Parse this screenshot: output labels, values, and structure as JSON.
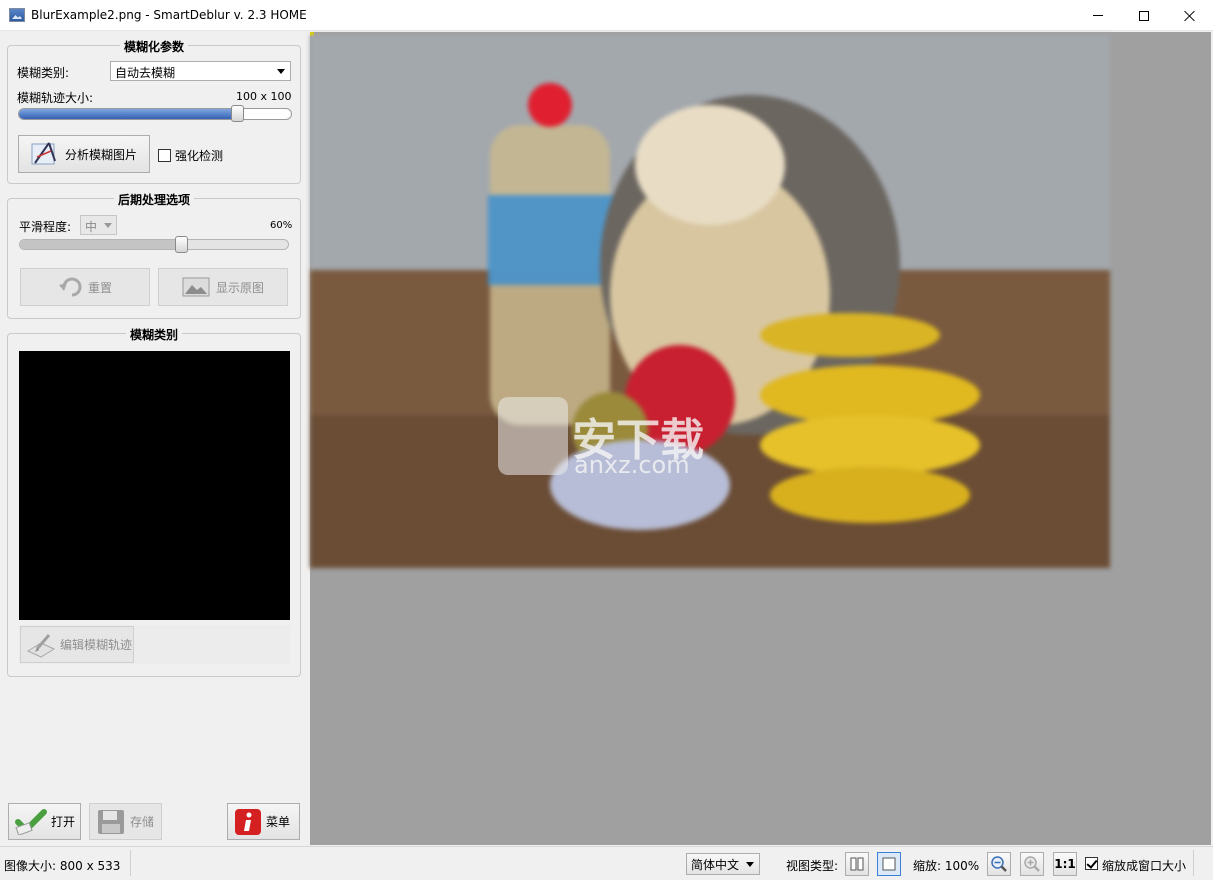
{
  "window": {
    "title": "BlurExample2.png - SmartDeblur v. 2.3 HOME"
  },
  "blur_params": {
    "group_title": "模糊化参数",
    "type_label": "模糊类别:",
    "type_value": "自动去模糊",
    "size_label": "模糊轨迹大小:",
    "size_value_w": "100",
    "size_value_x": "x",
    "size_value_h": "100",
    "size_slider_fraction": 0.8,
    "analyze_button": "分析模糊图片",
    "enhance_checkbox_label": "强化检测",
    "enhance_checked": false
  },
  "post_processing": {
    "group_title": "后期处理选项",
    "smooth_label": "平滑程度:",
    "smooth_value": "中",
    "smooth_percent": "60%",
    "smooth_slider_fraction": 0.6,
    "reset_button": "重置",
    "show_original_button": "显示原图"
  },
  "blur_kernel": {
    "group_title": "模糊类别",
    "edit_button": "编辑模糊轨迹"
  },
  "bottom_buttons": {
    "open": "打开",
    "save": "存储",
    "menu": "菜单"
  },
  "canvas": {
    "watermark_text": "安下载",
    "watermark_sub": "anxz.com"
  },
  "status": {
    "image_size": "图像大小: 800 x 533",
    "language": "简体中文",
    "view_type_label": "视图类型:",
    "zoom_label": "缩放: 100%",
    "one_to_one": "1:1",
    "fit_window_label": "缩放成窗口大小",
    "fit_window_checked": true
  },
  "colors": {
    "slider_blue": "#3461b5",
    "viewport_bg": "#a0a0a0",
    "menu_red": "#d42020",
    "open_green": "#4aa040"
  }
}
